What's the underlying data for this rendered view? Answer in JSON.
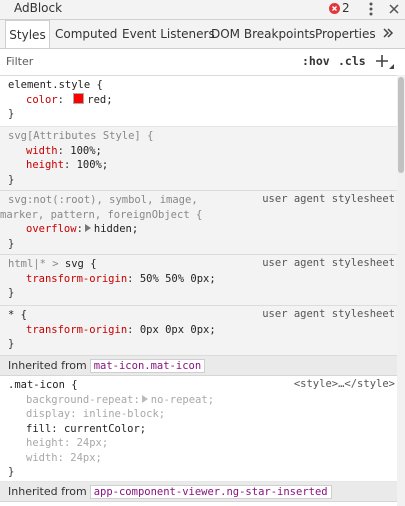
{
  "window": {
    "title": "AdBlock",
    "error_count": "2"
  },
  "tabs": [
    "Styles",
    "Computed",
    "Event Listeners",
    "DOM Breakpoints",
    "Properties"
  ],
  "filter": {
    "placeholder": "Filter",
    "hov": ":hov",
    "cls": ".cls"
  },
  "icons": {
    "error": "error-circle-icon",
    "menu": "kebab-menu-icon",
    "close": "close-icon",
    "more_tabs": "double-chevron-icon",
    "new_rule": "plus-icon",
    "color_swatch": "color-swatch-icon",
    "expand": "expand-triangle-icon"
  },
  "colors": {
    "swatch": "#ff0000",
    "property": "#c80000",
    "error_badge": "#e0373c"
  },
  "rules": {
    "r1": {
      "selector": "element.style {",
      "close": "}",
      "d1": {
        "name": "color",
        "value": "red;"
      }
    },
    "r2": {
      "selector": "svg[Attributes Style] {",
      "close": "}",
      "d1": {
        "name": "width",
        "value": "100%;"
      },
      "d2": {
        "name": "height",
        "value": "100%;"
      }
    },
    "r3": {
      "selector_line1": "svg:not(:root), symbol, image,",
      "selector_line2": "marker, pattern, foreignObject {",
      "origin": "user agent stylesheet",
      "close": "}",
      "d1": {
        "name": "overflow",
        "value": "hidden;"
      }
    },
    "r4": {
      "selector_part1": "html|* > ",
      "selector_part2": "svg {",
      "origin": "user agent stylesheet",
      "close": "}",
      "d1": {
        "name": "transform-origin",
        "value": "50% 50% 0px;"
      }
    },
    "r5": {
      "selector": "* {",
      "origin": "user agent stylesheet",
      "close": "}",
      "d1": {
        "name": "transform-origin",
        "value": "0px 0px 0px;"
      }
    },
    "inherited1": {
      "label": "Inherited from",
      "source": "mat-icon.mat-icon"
    },
    "r6": {
      "selector": ".mat-icon {",
      "origin": "<style>…</style>",
      "close": "}",
      "d1": {
        "name": "background-repeat",
        "value": "no-repeat;"
      },
      "d2": {
        "name": "display",
        "value": "inline-block;"
      },
      "d3": {
        "name": "fill",
        "value": "currentColor;"
      },
      "d4": {
        "name": "height",
        "value": "24px;"
      },
      "d5": {
        "name": "width",
        "value": "24px;"
      }
    },
    "inherited2": {
      "label": "Inherited from",
      "source": "app-component-viewer.ng-star-inserted"
    }
  }
}
